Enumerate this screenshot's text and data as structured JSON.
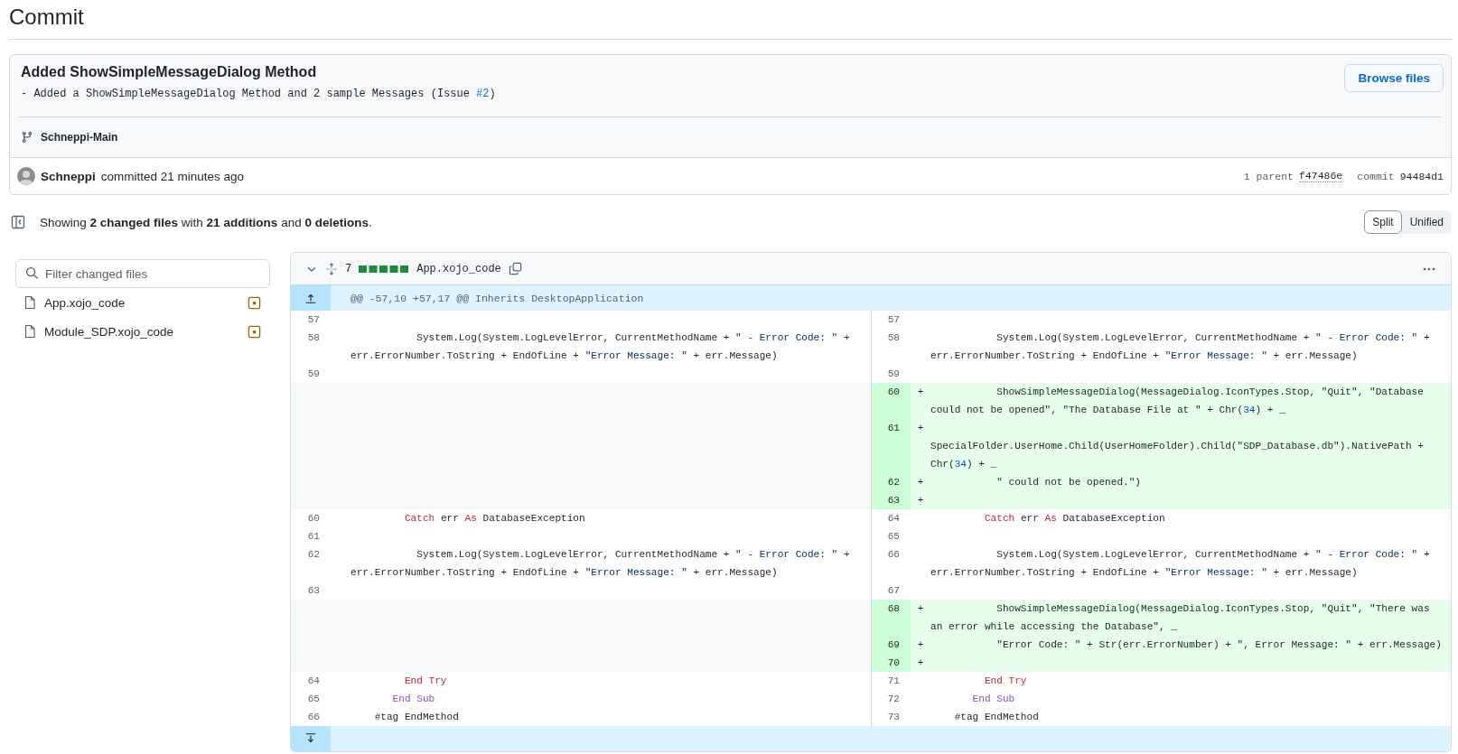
{
  "page_title": "Commit",
  "commit": {
    "title": "Added ShowSimpleMessageDialog Method",
    "message": "- Added a ShowSimpleMessageDialog Method and 2 sample Messages (Issue ",
    "issue_link": "#2",
    "message_end": ")",
    "browse_button": "Browse files",
    "branch": "Schneppi-Main",
    "author": "Schneppi",
    "action": "committed 21 minutes ago",
    "parent_label": "1 parent",
    "parent_sha": "f47486e",
    "commit_label": "commit",
    "commit_sha": "94484d1"
  },
  "summary": "Showing **2 changed files** with **21 additions** and **0 deletions**.",
  "view_modes": [
    {
      "label": "Split",
      "selected": true
    },
    {
      "label": "Unified",
      "selected": false
    }
  ],
  "filter": {
    "placeholder": "Filter changed files"
  },
  "files": [
    {
      "name": "App.xojo_code",
      "kind": "modified"
    },
    {
      "name": "Module_SDP.xojo_code",
      "kind": "modified"
    }
  ],
  "diff": {
    "count": "7",
    "file_name": "App.xojo_code",
    "hunk": "@@ -57,10 +57,17 @@ Inherits DesktopApplication",
    "rows": [
      {
        "left": {
          "num": "57",
          "kind": "context"
        },
        "right": {
          "num": "57",
          "kind": "context"
        }
      },
      {
        "left": {
          "num": "58",
          "kind": "context",
          "code": [
            {
              "t": "           System.Log(System.LogLevelError, CurrentMethodName + ",
              "kind": "plain"
            },
            {
              "t": "\" - Error Code: \"",
              "kind": "string"
            },
            {
              "t": " + err.ErrorNumber.ToString + EndOfLine + ",
              "kind": "plain"
            },
            {
              "t": "\"Error Message: \"",
              "kind": "string"
            },
            {
              "t": " + err.Message)",
              "kind": "plain"
            }
          ]
        },
        "right": {
          "num": "58",
          "kind": "context",
          "code": [
            {
              "t": "           System.Log(System.LogLevelError, CurrentMethodName + ",
              "kind": "plain"
            },
            {
              "t": "\" - Error Code: \"",
              "kind": "string"
            },
            {
              "t": " + err.ErrorNumber.ToString + EndOfLine + ",
              "kind": "plain"
            },
            {
              "t": "\"Error Message: \"",
              "kind": "string"
            },
            {
              "t": " + err.Message)",
              "kind": "plain"
            }
          ]
        }
      },
      {
        "left": {
          "num": "59",
          "kind": "context"
        },
        "right": {
          "num": "59",
          "kind": "context"
        }
      },
      {
        "right": {
          "num": "60",
          "kind": "added",
          "marker": "+",
          "code": [
            {
              "t": "           ShowSimpleMessageDialog(MessageDialog.IconTypes.Stop, \"Quit\", \"Database could not be opened\", \"The Database File at \" + Chr(",
              "kind": "plain"
            },
            {
              "t": "34",
              "kind": "number"
            },
            {
              "t": ") + _",
              "kind": "plain"
            }
          ]
        }
      },
      {
        "right": {
          "num": "61",
          "kind": "added",
          "marker": "+",
          "code": [
            {
              "t": "           SpecialFolder.UserHome.Child(UserHomeFolder).Child(\"SDP_Database.db\").NativePath + Chr(",
              "kind": "plain"
            },
            {
              "t": "34",
              "kind": "number"
            },
            {
              "t": ") + _",
              "kind": "plain"
            }
          ]
        }
      },
      {
        "right": {
          "num": "62",
          "kind": "added",
          "marker": "+",
          "code": [
            {
              "t": "           \" could not be opened.\")",
              "kind": "plain"
            }
          ]
        }
      },
      {
        "right": {
          "num": "63",
          "kind": "added",
          "marker": "+"
        }
      },
      {
        "left": {
          "num": "60",
          "kind": "context",
          "code": [
            {
              "t": "         Catch",
              "kind": "keyword"
            },
            {
              "t": " err ",
              "kind": "plain"
            },
            {
              "t": "As",
              "kind": "keyword"
            },
            {
              "t": " DatabaseException",
              "kind": "plain"
            }
          ]
        },
        "right": {
          "num": "64",
          "kind": "context",
          "code": [
            {
              "t": "         Catch",
              "kind": "keyword"
            },
            {
              "t": " err ",
              "kind": "plain"
            },
            {
              "t": "As",
              "kind": "keyword"
            },
            {
              "t": " DatabaseException",
              "kind": "plain"
            }
          ]
        }
      },
      {
        "left": {
          "num": "61",
          "kind": "context"
        },
        "right": {
          "num": "65",
          "kind": "context"
        }
      },
      {
        "left": {
          "num": "62",
          "kind": "context",
          "code": [
            {
              "t": "           System.Log(System.LogLevelError, CurrentMethodName + ",
              "kind": "plain"
            },
            {
              "t": "\" - Error Code: \"",
              "kind": "string"
            },
            {
              "t": " + err.ErrorNumber.ToString + EndOfLine + ",
              "kind": "plain"
            },
            {
              "t": "\"Error Message: \"",
              "kind": "string"
            },
            {
              "t": " + err.Message)",
              "kind": "plain"
            }
          ]
        },
        "right": {
          "num": "66",
          "kind": "context",
          "code": [
            {
              "t": "           System.Log(System.LogLevelError, CurrentMethodName + ",
              "kind": "plain"
            },
            {
              "t": "\" - Error Code: \"",
              "kind": "string"
            },
            {
              "t": " + err.ErrorNumber.ToString + EndOfLine + ",
              "kind": "plain"
            },
            {
              "t": "\"Error Message: \"",
              "kind": "string"
            },
            {
              "t": " + err.Message)",
              "kind": "plain"
            }
          ]
        }
      },
      {
        "left": {
          "num": "63",
          "kind": "context"
        },
        "right": {
          "num": "67",
          "kind": "context"
        }
      },
      {
        "right": {
          "num": "68",
          "kind": "added",
          "marker": "+",
          "code": [
            {
              "t": "           ShowSimpleMessageDialog(MessageDialog.IconTypes.Stop, \"Quit\", \"There was an error while accessing the Database\", _",
              "kind": "plain"
            }
          ]
        }
      },
      {
        "right": {
          "num": "69",
          "kind": "added",
          "marker": "+",
          "code": [
            {
              "t": "           \"Error Code: \" + Str(err.ErrorNumber) + \", Error Message: \" + err.Message)",
              "kind": "plain"
            }
          ]
        }
      },
      {
        "right": {
          "num": "70",
          "kind": "added",
          "marker": "+"
        }
      },
      {
        "left": {
          "num": "64",
          "kind": "context",
          "code": [
            {
              "t": "         End Try",
              "kind": "keyword"
            }
          ]
        },
        "right": {
          "num": "71",
          "kind": "context",
          "code": [
            {
              "t": "         End Try",
              "kind": "keyword"
            }
          ]
        }
      },
      {
        "left": {
          "num": "65",
          "kind": "context",
          "code": [
            {
              "t": "       End Sub",
              "kind": "storage"
            }
          ]
        },
        "right": {
          "num": "72",
          "kind": "context",
          "code": [
            {
              "t": "       End Sub",
              "kind": "storage"
            }
          ]
        }
      },
      {
        "left": {
          "num": "66",
          "kind": "context",
          "code": [
            {
              "t": "    #tag EndMethod",
              "kind": "plain"
            }
          ]
        },
        "right": {
          "num": "73",
          "kind": "context",
          "code": [
            {
              "t": "    #tag EndMethod",
              "kind": "plain"
            }
          ]
        }
      }
    ]
  }
}
